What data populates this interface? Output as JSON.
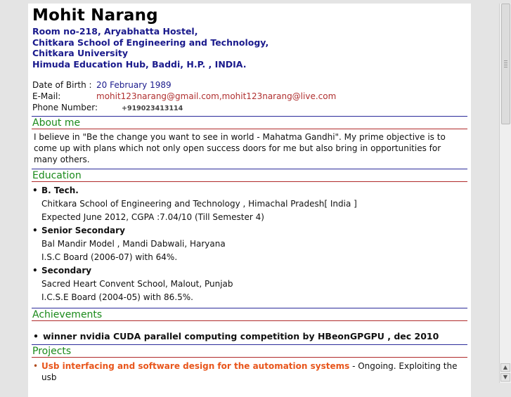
{
  "header": {
    "name": "Mohit Narang",
    "address": [
      "Room no-218,  Aryabhatta Hostel,",
      "Chitkara School of Engineering and Technology,",
      "Chitkara University",
      "Himuda Education Hub, Baddi, H.P. , INDIA."
    ]
  },
  "info": {
    "dob_label": "Date of Birth :",
    "dob_value": "20 February 1989",
    "email_label": "E-Mail:",
    "email_value": "mohit123narang@gmail.com,mohit123narang@live.com",
    "phone_label": "Phone Number:",
    "phone_value": "+919023413114"
  },
  "about": {
    "heading": "About me",
    "text": "I believe in \"Be the change you want to see in world - Mahatma Gandhi\". My prime objective is to come up with plans which not only open success doors for me but also bring in opportunities for many others."
  },
  "education": {
    "heading": "Education",
    "items": [
      {
        "degree": "B. Tech.",
        "line1": "Chitkara School of Engineering and Technology , Himachal Pradesh[ India ]",
        "line2": "Expected June 2012, CGPA :7.04/10 (Till Semester 4)"
      },
      {
        "degree": "Senior Secondary",
        "line1": "Bal Mandir Model , Mandi Dabwali, Haryana",
        "line2": "I.S.C Board (2006-07) with 64%."
      },
      {
        "degree": "Secondary",
        "line1": "Sacred Heart Convent School, Malout, Punjab",
        "line2": "I.C.S.E Board (2004-05) with 86.5%."
      }
    ]
  },
  "achievements": {
    "heading": "Achievements",
    "item": "winner nvidia CUDA parallel computing competition by HBeonGPGPU , dec 2010"
  },
  "projects": {
    "heading": "Projects",
    "title": "Usb interfacing and software design for the automation systems",
    "desc": " - Ongoing. Exploiting the usb"
  }
}
